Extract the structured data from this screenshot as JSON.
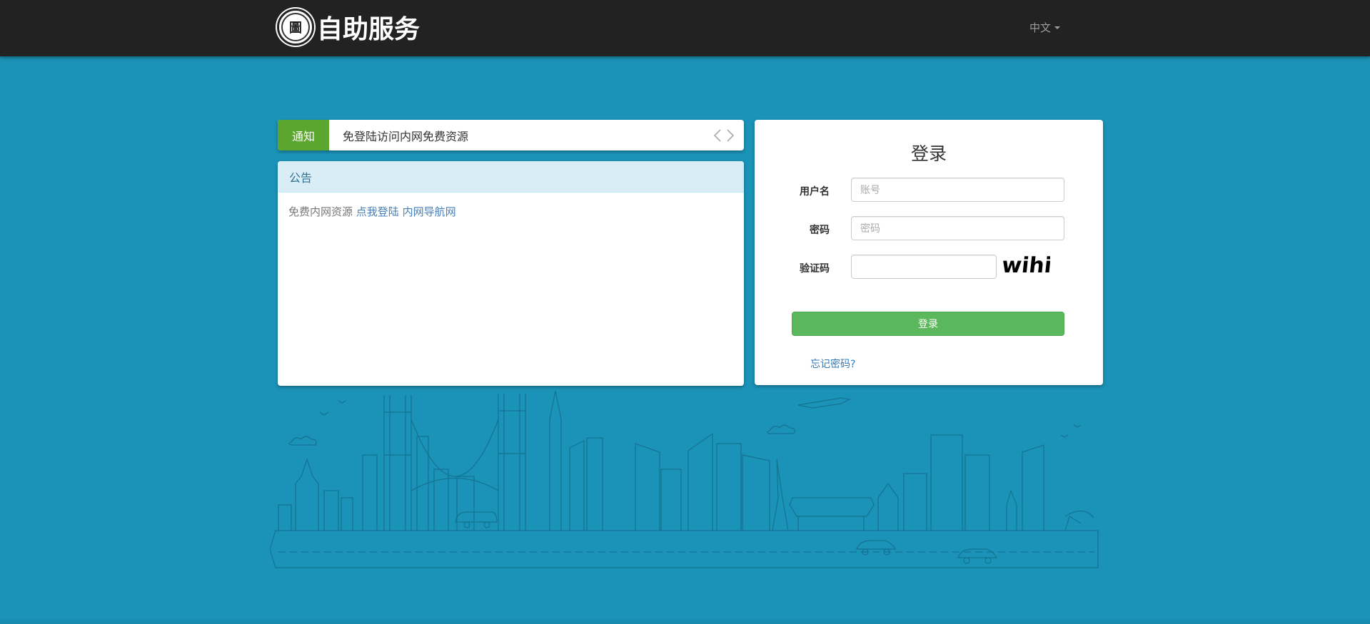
{
  "header": {
    "logo_text": "自助服务",
    "logo_seal_char": "圖",
    "language": "中文"
  },
  "notice": {
    "tag": "通知",
    "text": "免登陆访问内网免费资源",
    "prev_icon": "chevron-left-icon",
    "next_icon": "chevron-right-icon"
  },
  "announcement": {
    "title": "公告",
    "text": "免费内网资源",
    "links": [
      "点我登陆",
      "内网导航网"
    ]
  },
  "login": {
    "title": "登录",
    "username_label": "用户名",
    "username_placeholder": "账号",
    "password_label": "密码",
    "password_placeholder": "密码",
    "captcha_label": "验证码",
    "captcha_text": "wihi",
    "submit_label": "登录",
    "forgot_label": "忘记密码?"
  },
  "colors": {
    "background": "#1b92b7",
    "topbar": "#222222",
    "notice_tag": "#5aa62f",
    "login_button": "#5cb85c",
    "link": "#337ab7"
  }
}
